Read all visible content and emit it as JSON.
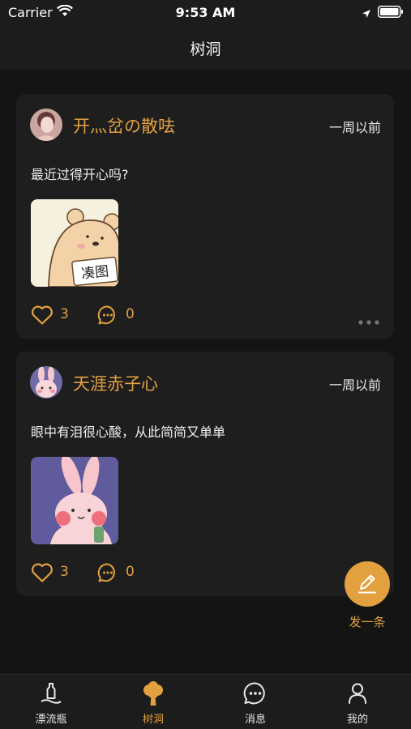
{
  "status_bar": {
    "carrier": "Carrier",
    "time": "9:53 AM"
  },
  "nav": {
    "title": "树洞"
  },
  "posts": [
    {
      "username": "开灬岔の散呿",
      "time": "一周以前",
      "text": "最近过得开心吗?",
      "likes": "3",
      "comments": "0",
      "image_caption": "凑图"
    },
    {
      "username": "天涯赤子心",
      "time": "一周以前",
      "text": "眼中有泪很心酸，从此简简又单单",
      "likes": "3",
      "comments": "0"
    }
  ],
  "fab": {
    "label": "发一条"
  },
  "tabs": [
    {
      "label": "漂流瓶",
      "icon": "bottle-icon"
    },
    {
      "label": "树洞",
      "icon": "tree-icon"
    },
    {
      "label": "消息",
      "icon": "message-icon"
    },
    {
      "label": "我的",
      "icon": "profile-icon"
    }
  ],
  "colors": {
    "accent": "#e3a03f",
    "background": "#141414",
    "card": "#1e1e1e"
  }
}
